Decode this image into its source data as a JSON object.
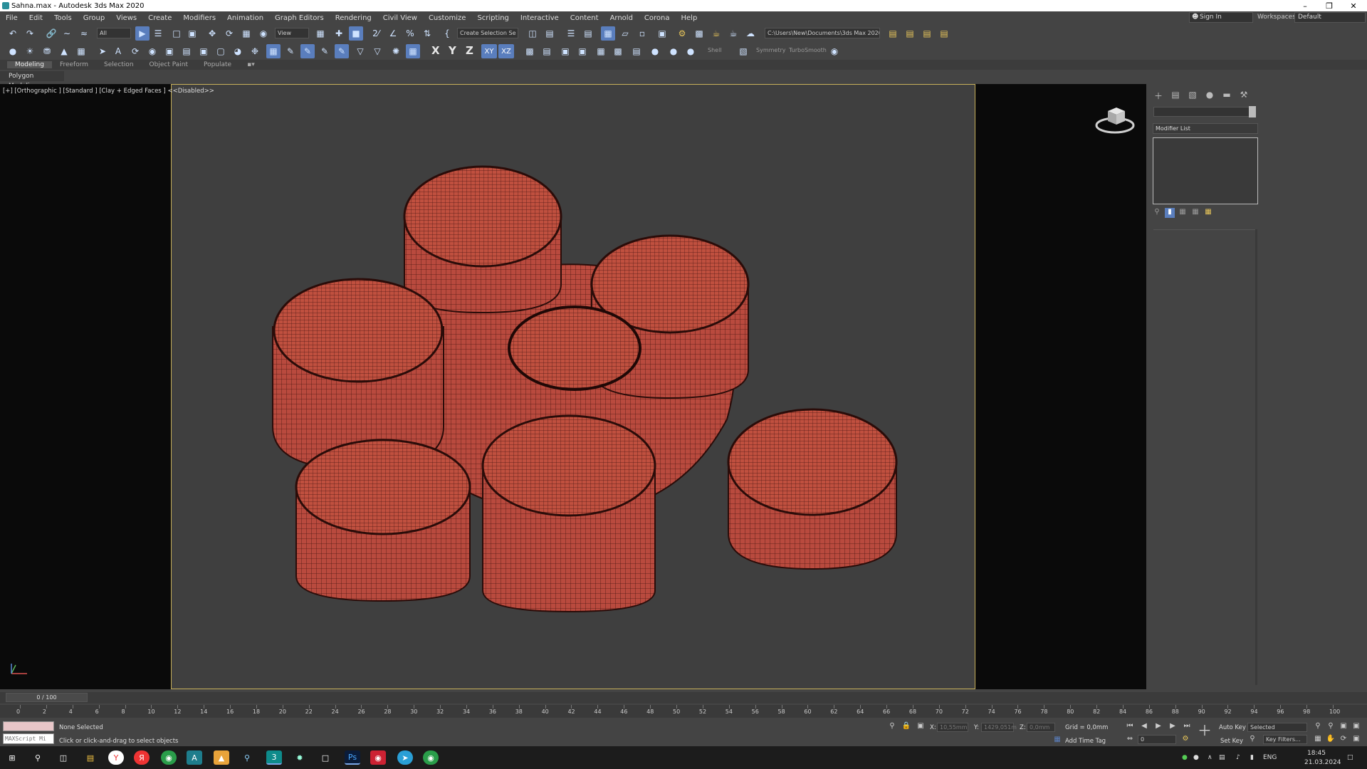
{
  "window": {
    "title": "Sahna.max - Autodesk 3ds Max 2020"
  },
  "menu": [
    "File",
    "Edit",
    "Tools",
    "Group",
    "Views",
    "Create",
    "Modifiers",
    "Animation",
    "Graph Editors",
    "Rendering",
    "Civil View",
    "Customize",
    "Scripting",
    "Interactive",
    "Content",
    "Arnold",
    "Corona",
    "Help"
  ],
  "account": {
    "sign_in": "Sign In",
    "workspaces_label": "Workspaces:",
    "workspace": "Default"
  },
  "toolbar": {
    "selection_filter": "All",
    "ref_coord": "View",
    "named_selection": "Create Selection Se",
    "project_path": "C:\\Users\\New\\Documents\\3ds Max 2020",
    "axis_x": "X",
    "axis_y": "Y",
    "axis_z": "Z",
    "axis_xy": "XY",
    "axis_xz": "XZ",
    "shell": "Shell",
    "symmetry": "Symmetry",
    "turbosmooth": "TurboSmooth"
  },
  "ribbon": {
    "tabs": [
      "Modeling",
      "Freeform",
      "Selection",
      "Object Paint",
      "Populate"
    ],
    "panel": "Polygon Modeling"
  },
  "viewport": {
    "label": "[+] [Orthographic ] [Standard ] [Clay + Edged Faces ]  <<Disabled>>"
  },
  "command_panel": {
    "modifier_list": "Modifier List"
  },
  "timeline": {
    "slider": "0 / 100",
    "ticks": [
      "0",
      "2",
      "4",
      "6",
      "8",
      "10",
      "12",
      "14",
      "16",
      "18",
      "20",
      "22",
      "24",
      "26",
      "28",
      "30",
      "32",
      "34",
      "36",
      "38",
      "40",
      "42",
      "44",
      "46",
      "48",
      "50",
      "52",
      "54",
      "56",
      "58",
      "60",
      "62",
      "64",
      "66",
      "68",
      "70",
      "72",
      "74",
      "76",
      "78",
      "80",
      "82",
      "84",
      "86",
      "88",
      "90",
      "92",
      "94",
      "96",
      "98",
      "100"
    ]
  },
  "status": {
    "selection": "None Selected",
    "prompt": "Click or click-and-drag to select objects",
    "maxscript": "MAXScript Mi",
    "x_label": "X:",
    "x_value": "10,55mm",
    "y_label": "Y:",
    "y_value": "1429,051m",
    "z_label": "Z:",
    "z_value": "0,0mm",
    "grid": "Grid = 0,0mm",
    "add_time_tag": "Add Time Tag",
    "auto_key": "Auto Key",
    "set_key": "Set Key",
    "key_mode": "Selected",
    "key_filters": "Key Filters...",
    "frame": "0"
  },
  "taskbar": {
    "lang": "ENG",
    "time": "18:45",
    "date": "21.03.2024"
  },
  "colors": {
    "model_fill": "#b94a3e",
    "viewport_bg": "#3f3f3f",
    "active_border": "#c7b05a",
    "accent": "#5a7ebd"
  }
}
